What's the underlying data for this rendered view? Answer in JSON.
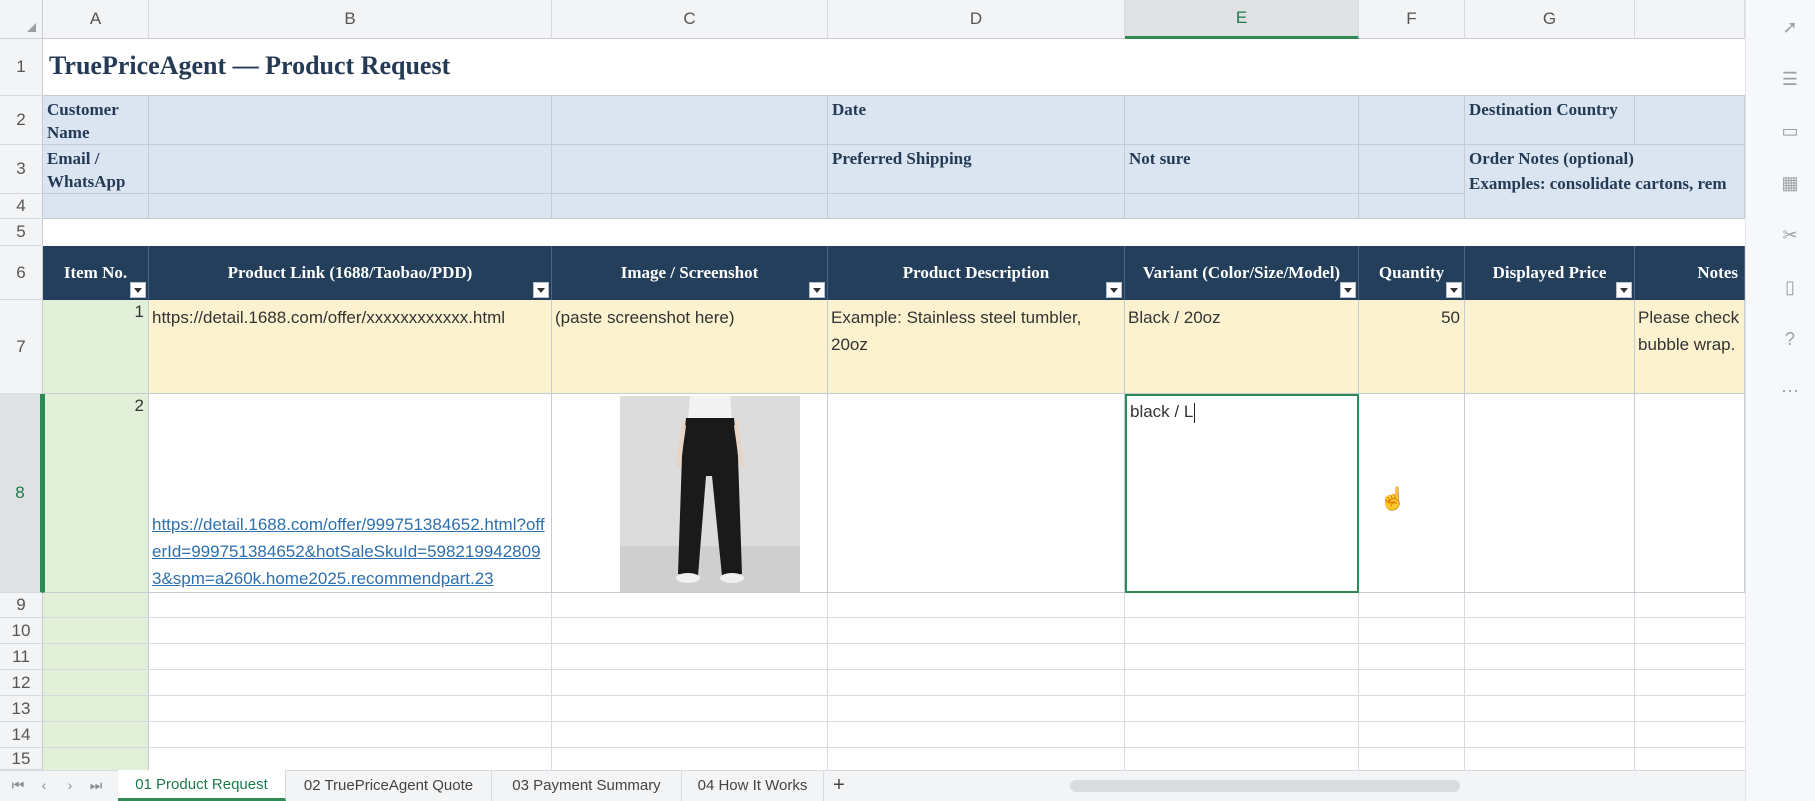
{
  "columns": [
    "A",
    "B",
    "C",
    "D",
    "E",
    "F",
    "G",
    ""
  ],
  "rows": [
    "1",
    "2",
    "3",
    "4",
    "5",
    "6",
    "7",
    "8",
    "9",
    "10",
    "11",
    "12",
    "13",
    "14",
    "15"
  ],
  "title": "TruePriceAgent — Product Request",
  "info": {
    "customer_name_label": "Customer Name",
    "date_label": "Date",
    "destination_label": "Destination Country",
    "email_label": "Email / WhatsApp",
    "shipping_label": "Preferred Shipping",
    "shipping_value": "Not sure",
    "notes_label": "Order Notes (optional)",
    "notes_example": "Examples: consolidate cartons, rem"
  },
  "table_headers": [
    "Item No.",
    "Product Link (1688/Taobao/PDD)",
    "Image / Screenshot",
    "Product Description",
    "Variant (Color/Size/Model)",
    "Quantity",
    "Displayed Price",
    "Notes"
  ],
  "rows_data": [
    {
      "item_no": "1",
      "link": "https://detail.1688.com/offer/xxxxxxxxxxxx.html",
      "image": "(paste screenshot here)",
      "description": "Example: Stainless steel tumbler, 20oz",
      "variant": "Black / 20oz",
      "quantity": "50",
      "price": "",
      "notes": "Please check bubble wrap."
    },
    {
      "item_no": "2",
      "link": "https://detail.1688.com/offer/999751384652.html?offerId=999751384652&hotSaleSkuId=5982199428093&spm=a260k.home2025.recommendpart.23",
      "image_alt": "black-trousers-photo",
      "description": "",
      "variant": "black / L",
      "quantity": "",
      "price": "",
      "notes": ""
    }
  ],
  "sheet_tabs": [
    "01 Product Request",
    "02 TruePriceAgent Quote",
    "03 Payment Summary",
    "04 How It Works"
  ],
  "add_tab": "+",
  "side_icons": [
    "cursor-icon",
    "sliders-icon",
    "comment-icon",
    "cells-icon",
    "tools-icon",
    "book-icon",
    "help-icon",
    "more-icon"
  ],
  "colors": {
    "header_navy": "#243f5c",
    "info_blue": "#dbe5f1",
    "row_yellow": "#fcf2d0",
    "active_green": "#2e8b57"
  }
}
